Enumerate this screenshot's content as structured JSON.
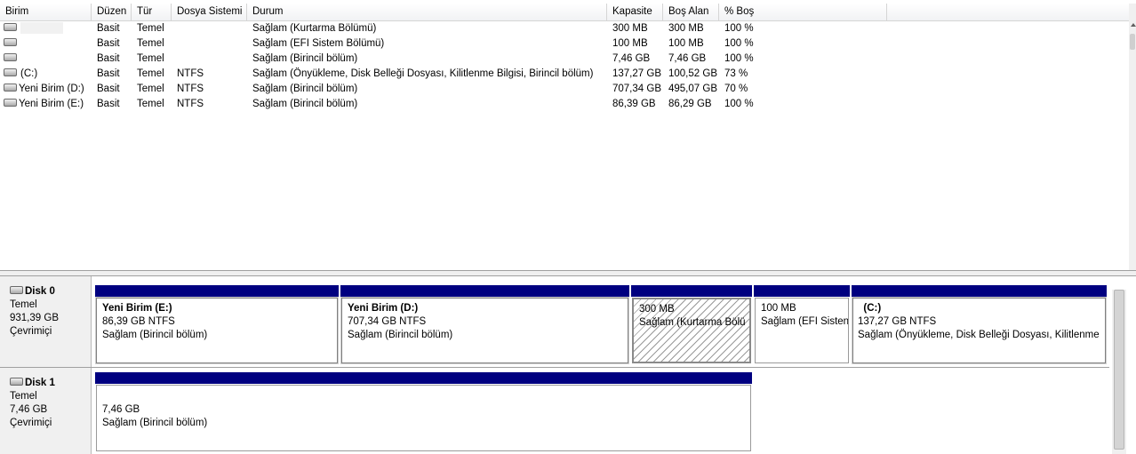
{
  "volume_list": {
    "columns": [
      "Birim",
      "Düzen",
      "Tür",
      "Dosya Sistemi",
      "Durum",
      "Kapasite",
      "Boş Alan",
      "% Boş"
    ],
    "rows": [
      {
        "name": "",
        "layout": "Basit",
        "type": "Temel",
        "fs": "",
        "status": "Sağlam (Kurtarma Bölümü)",
        "capacity": "300 MB",
        "free": "300 MB",
        "pct": "100 %"
      },
      {
        "name": "",
        "layout": "Basit",
        "type": "Temel",
        "fs": "",
        "status": "Sağlam (EFI Sistem Bölümü)",
        "capacity": "100 MB",
        "free": "100 MB",
        "pct": "100 %"
      },
      {
        "name": "",
        "layout": "Basit",
        "type": "Temel",
        "fs": "",
        "status": "Sağlam (Birincil bölüm)",
        "capacity": "7,46 GB",
        "free": "7,46 GB",
        "pct": "100 %"
      },
      {
        "name": "(C:)",
        "layout": "Basit",
        "type": "Temel",
        "fs": "NTFS",
        "status": "Sağlam (Önyükleme, Disk Belleği Dosyası, Kilitlenme Bilgisi, Birincil bölüm)",
        "capacity": "137,27 GB",
        "free": "100,52 GB",
        "pct": "73 %"
      },
      {
        "name": "Yeni Birim (D:)",
        "layout": "Basit",
        "type": "Temel",
        "fs": "NTFS",
        "status": "Sağlam (Birincil bölüm)",
        "capacity": "707,34 GB",
        "free": "495,07 GB",
        "pct": "70 %"
      },
      {
        "name": "Yeni Birim (E:)",
        "layout": "Basit",
        "type": "Temel",
        "fs": "NTFS",
        "status": "Sağlam (Birincil bölüm)",
        "capacity": "86,39 GB",
        "free": "86,29 GB",
        "pct": "100 %"
      }
    ]
  },
  "disks": [
    {
      "title": "Disk 0",
      "type": "Temel",
      "size": "931,39 GB",
      "state": "Çevrimiçi",
      "partitions": [
        {
          "name": "Yeni Birim  (E:)",
          "size": "86,39 GB NTFS",
          "status": "Sağlam (Birincil bölüm)"
        },
        {
          "name": "Yeni Birim  (D:)",
          "size": "707,34 GB NTFS",
          "status": "Sağlam (Birincil bölüm)"
        },
        {
          "name": "",
          "size": "300 MB",
          "status": "Sağlam (Kurtarma Bölü"
        },
        {
          "name": "",
          "size": "100 MB",
          "status": "Sağlam (EFI Sisten"
        },
        {
          "name": "  (C:)",
          "size": "137,27 GB NTFS",
          "status": "Sağlam (Önyükleme, Disk Belleği Dosyası, Kilitlenme"
        }
      ]
    },
    {
      "title": "Disk 1",
      "type": "Temel",
      "size": "7,46 GB",
      "state": "Çevrimiçi",
      "partitions": [
        {
          "name": "",
          "size": "7,46 GB",
          "status": "Sağlam (Birincil bölüm)"
        }
      ]
    }
  ],
  "colors": {
    "partition_bar": "#000080",
    "panel_bg": "#f0f0f0"
  },
  "icons": {
    "drive": "drive-icon"
  }
}
